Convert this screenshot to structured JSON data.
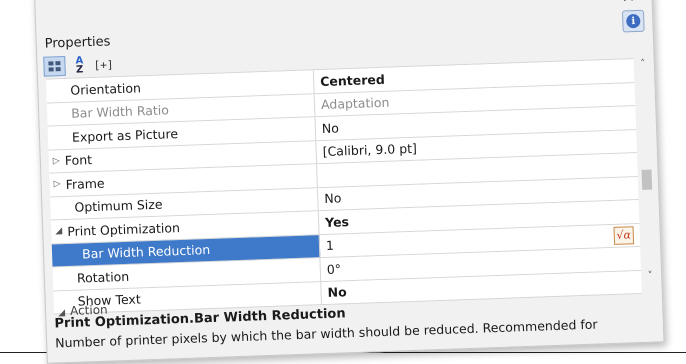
{
  "window": {
    "title": "Properties",
    "close_glyph": "×",
    "info_glyph": "i"
  },
  "toolbar": {
    "categorized_icon": "categorized-view-icon",
    "sort_glyph_top": "A",
    "sort_glyph_bottom": "Z",
    "expand_label": "[+]"
  },
  "rows": [
    {
      "name": "Orientation",
      "value": "Centered"
    },
    {
      "name": "Bar Width Ratio",
      "value": "Adaptation"
    },
    {
      "name": "Export as Picture",
      "value": "No"
    },
    {
      "name": "Font",
      "value": "[Calibri, 9.0 pt]"
    },
    {
      "name": "Frame",
      "value": ""
    },
    {
      "name": "Optimum Size",
      "value": "No"
    },
    {
      "name": "Print Optimization",
      "value": "Yes"
    },
    {
      "name": "Bar Width Reduction",
      "value": "1"
    },
    {
      "name": "Rotation",
      "value": "0°"
    },
    {
      "name": "Show Text",
      "value": "No"
    }
  ],
  "formula_button_label": "√α",
  "partial_category": "Action",
  "description": {
    "title": "Print Optimization.Bar Width Reduction",
    "text": "Number of printer pixels by which the bar width should be reduced. Recommended for"
  }
}
